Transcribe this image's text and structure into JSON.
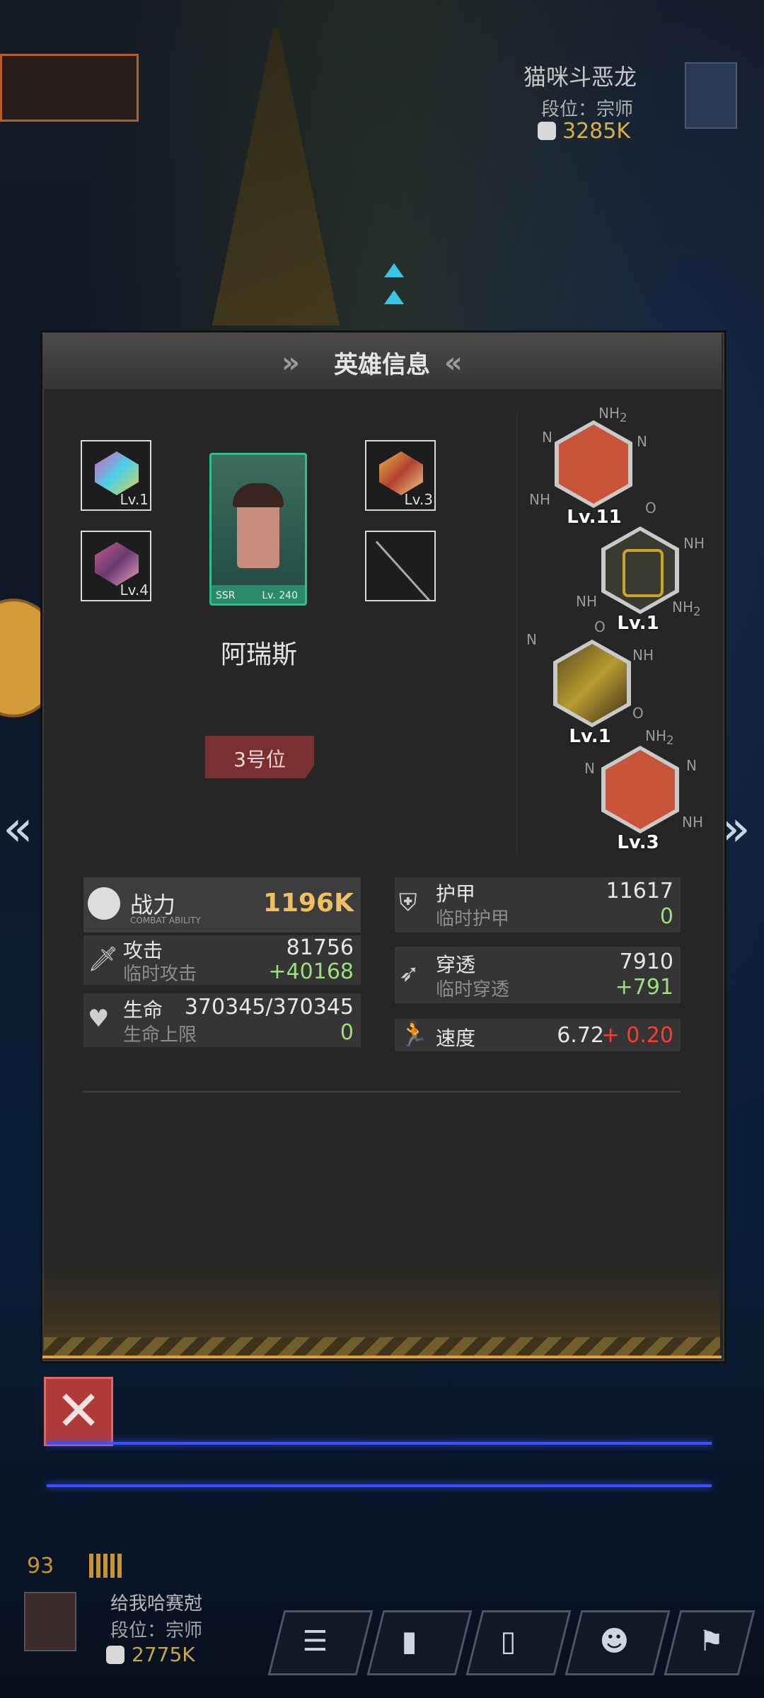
{
  "opponent": {
    "name": "猫咪斗恶龙",
    "rank": "段位：宗师",
    "power": "3285K"
  },
  "panel": {
    "title": "英雄信息"
  },
  "hero": {
    "name": "阿瑞斯",
    "rarity": "SSR",
    "level": "Lv. 240",
    "position": "3号位",
    "equipment": [
      {
        "slot": "top-left",
        "level": "Lv.1"
      },
      {
        "slot": "bottom-left",
        "level": "Lv.4"
      },
      {
        "slot": "top-right",
        "level": "Lv.3"
      },
      {
        "slot": "bottom-right",
        "level": ""
      }
    ]
  },
  "skills": [
    {
      "level": "Lv.11",
      "color": "#c8553a"
    },
    {
      "level": "Lv.1",
      "color": "#c9a62a"
    },
    {
      "level": "Lv.1",
      "color": "#b89a30"
    },
    {
      "level": "Lv.3",
      "color": "#c8553a"
    }
  ],
  "chem_labels": {
    "nh2": "NH",
    "two": "2",
    "n": "N",
    "nh": "NH",
    "o": "O"
  },
  "stats": {
    "power": {
      "label": "战力",
      "sub": "COMBAT ABILITY",
      "value": "1196K"
    },
    "attack": {
      "label": "攻击",
      "sub": "临时攻击",
      "value": "81756",
      "bonus": "+40168"
    },
    "hp": {
      "label": "生命",
      "sub": "生命上限",
      "value": "370345/370345",
      "bonus": "0"
    },
    "armor": {
      "label": "护甲",
      "sub": "临时护甲",
      "value": "11617",
      "bonus": "0"
    },
    "pierce": {
      "label": "穿透",
      "sub": "临时穿透",
      "value": "7910",
      "bonus": "+791"
    },
    "speed": {
      "label": "速度",
      "value": "6.72",
      "bonus": "+ 0.20"
    }
  },
  "player": {
    "name": "给我哈赛尅",
    "rank": "段位：宗师",
    "power": "2775K",
    "ping": "93"
  },
  "bottom_tabs": [
    "profile-icon",
    "stats-icon",
    "item-icon",
    "emoji-icon",
    "flag-icon"
  ],
  "icons": {
    "close": "✕",
    "left_arrow": "«",
    "right_arrow": "»"
  }
}
